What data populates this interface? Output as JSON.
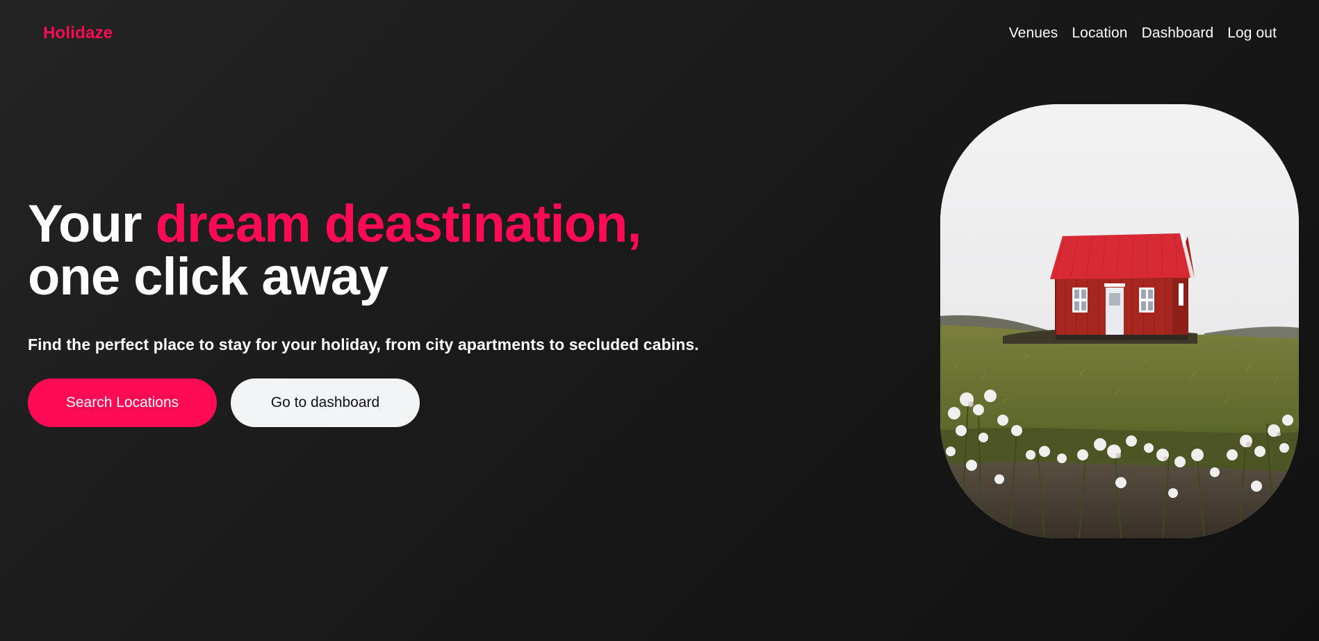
{
  "brand": {
    "name": "Holidaze",
    "accent_color": "#ff0a54"
  },
  "nav": {
    "items": [
      {
        "label": "Venues"
      },
      {
        "label": "Location"
      },
      {
        "label": "Dashboard"
      },
      {
        "label": "Log out"
      }
    ]
  },
  "hero": {
    "headline_prefix": "Your ",
    "headline_accent": "dream deastination,",
    "headline_line2": "one click away",
    "subtitle": "Find the perfect place to stay for your holiday, from city apartments to secluded cabins.",
    "primary_button": "Search Locations",
    "secondary_button": "Go to dashboard",
    "image_subject": "red-cabin-photo"
  },
  "colors": {
    "background": "#1a1a1a",
    "primary": "#ff0a54",
    "secondary_button_bg": "#f3f4f6",
    "text": "#ffffff"
  }
}
